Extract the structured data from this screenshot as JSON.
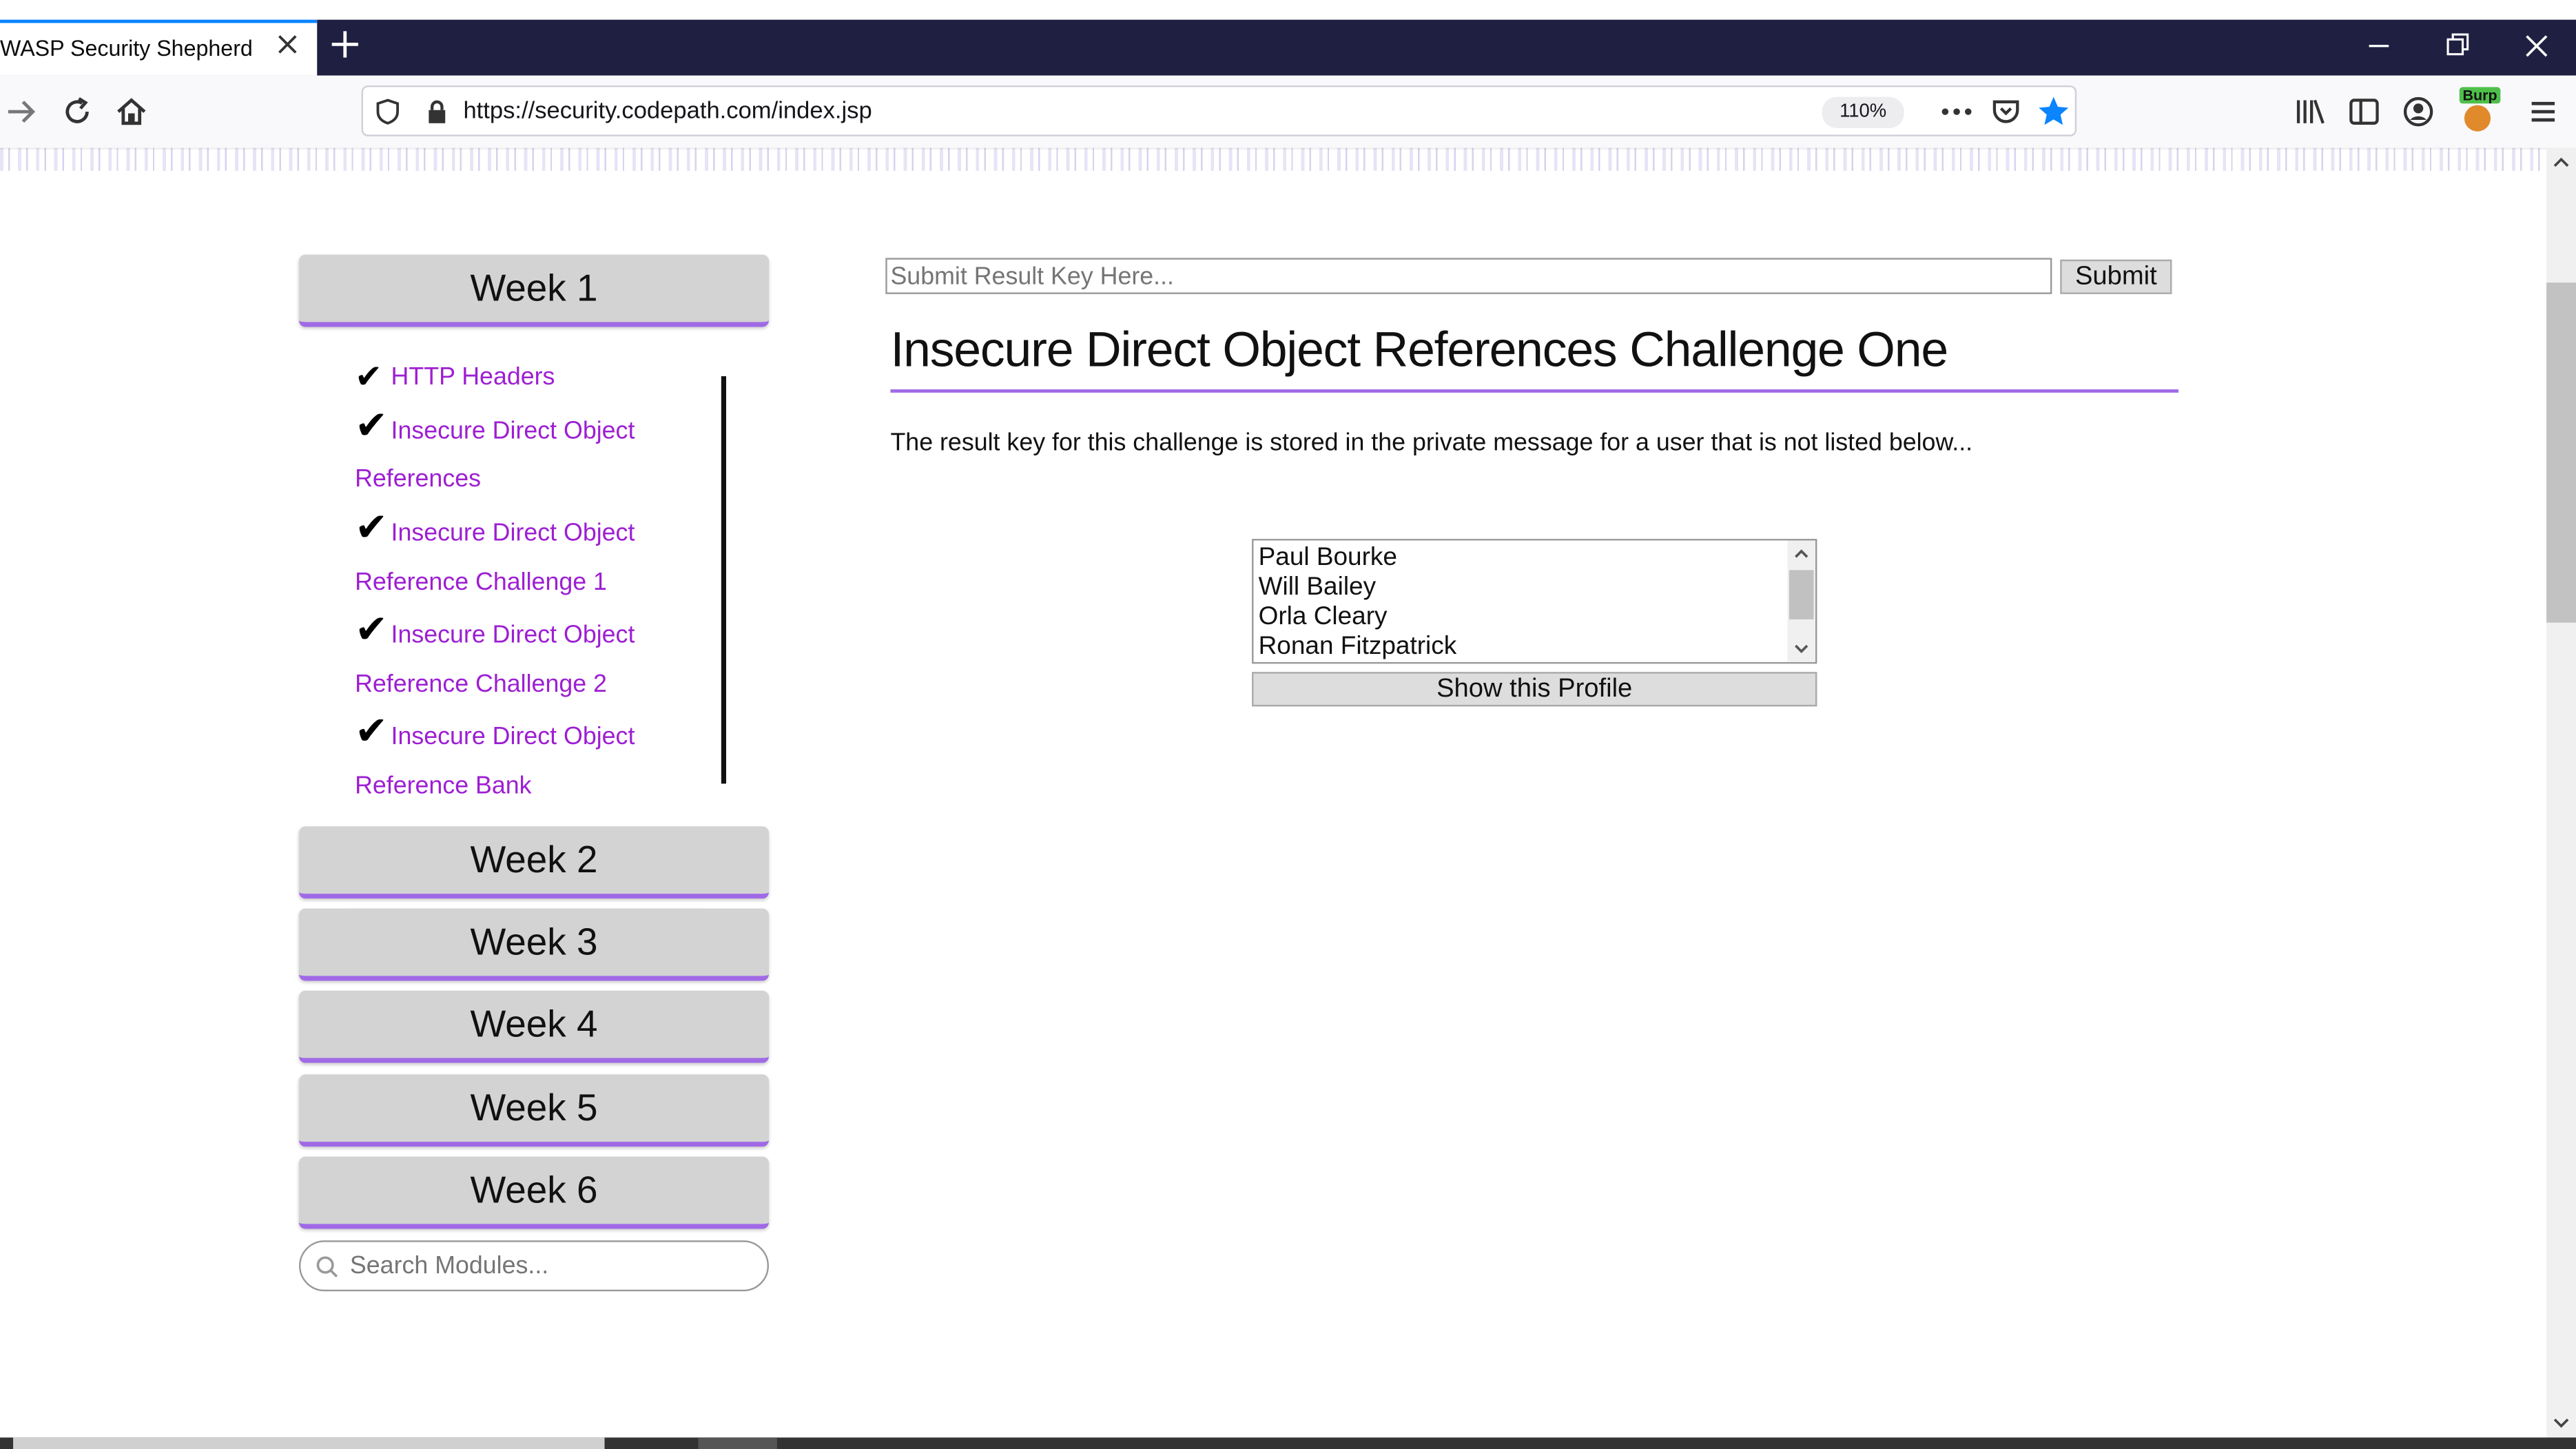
{
  "browser": {
    "tab_title": "WASP Security Shepherd",
    "url": "https://security.codepath.com/index.jsp",
    "zoom": "110%",
    "burp_label": "Burp"
  },
  "sidebar": {
    "weeks": [
      {
        "label": "Week 1"
      },
      {
        "label": "Week 2"
      },
      {
        "label": "Week 3"
      },
      {
        "label": "Week 4"
      },
      {
        "label": "Week 5"
      },
      {
        "label": "Week 6"
      }
    ],
    "check_glyph": "✔",
    "modules": [
      {
        "line1": "HTTP Headers",
        "line2": ""
      },
      {
        "line1": "Insecure Direct Object",
        "line2": "References"
      },
      {
        "line1": "Insecure Direct Object",
        "line2": "Reference Challenge 1"
      },
      {
        "line1": "Insecure Direct Object",
        "line2": "Reference Challenge 2"
      },
      {
        "line1": "Insecure Direct Object",
        "line2": "Reference Bank"
      }
    ],
    "search_placeholder": "Search Modules..."
  },
  "main": {
    "key_placeholder": "Submit Result Key Here...",
    "submit_label": "Submit",
    "title": "Insecure Direct Object References Challenge One",
    "description": "The result key for this challenge is stored in the private message for a user that is not listed below...",
    "users": [
      "Paul Bourke",
      "Will Bailey",
      "Orla Cleary",
      "Ronan Fitzpatrick"
    ],
    "show_profile_label": "Show this Profile"
  },
  "colors": {
    "accent": "#a06ae6",
    "link": "#9d1fd2",
    "titlebar": "#1f2041"
  }
}
